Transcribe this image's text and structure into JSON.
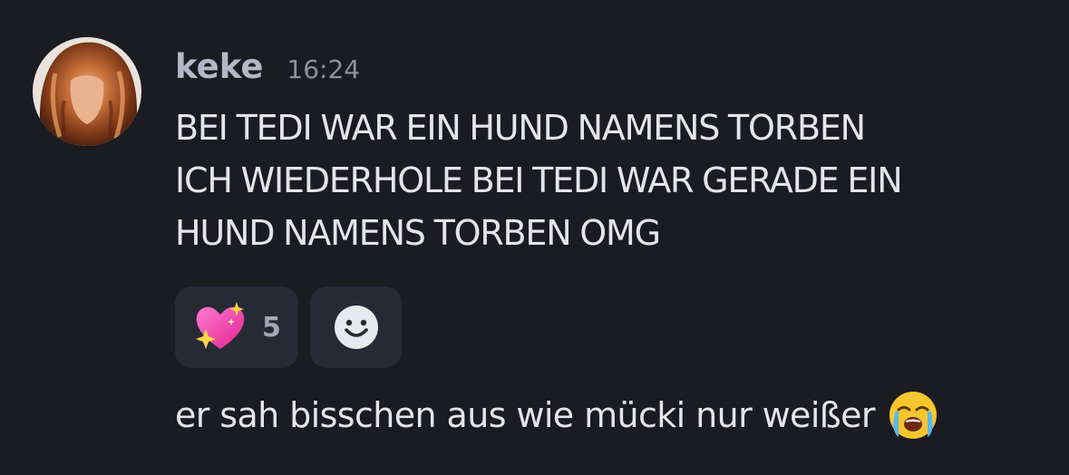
{
  "message": {
    "author": "keke",
    "timestamp": "16:24",
    "lines": [
      "BEI TEDI WAR EIN HUND NAMENS TORBEN",
      "ICH WIEDERHOLE BEI TEDI WAR GERADE EIN",
      "HUND NAMENS TORBEN OMG"
    ]
  },
  "reactions": [
    {
      "emoji": "sparkling-heart-icon",
      "count": "5"
    }
  ],
  "add_reaction": {
    "icon": "smiley-face-icon"
  },
  "followup": {
    "text": "er sah bisschen aus wie mücki nur weißer",
    "emoji": "loudly-crying-face-icon"
  },
  "colors": {
    "background": "#1b1b22",
    "pill": "#272a35",
    "username": "#b4b8c6",
    "text": "#e4e5ea",
    "muted": "#8e929f"
  }
}
